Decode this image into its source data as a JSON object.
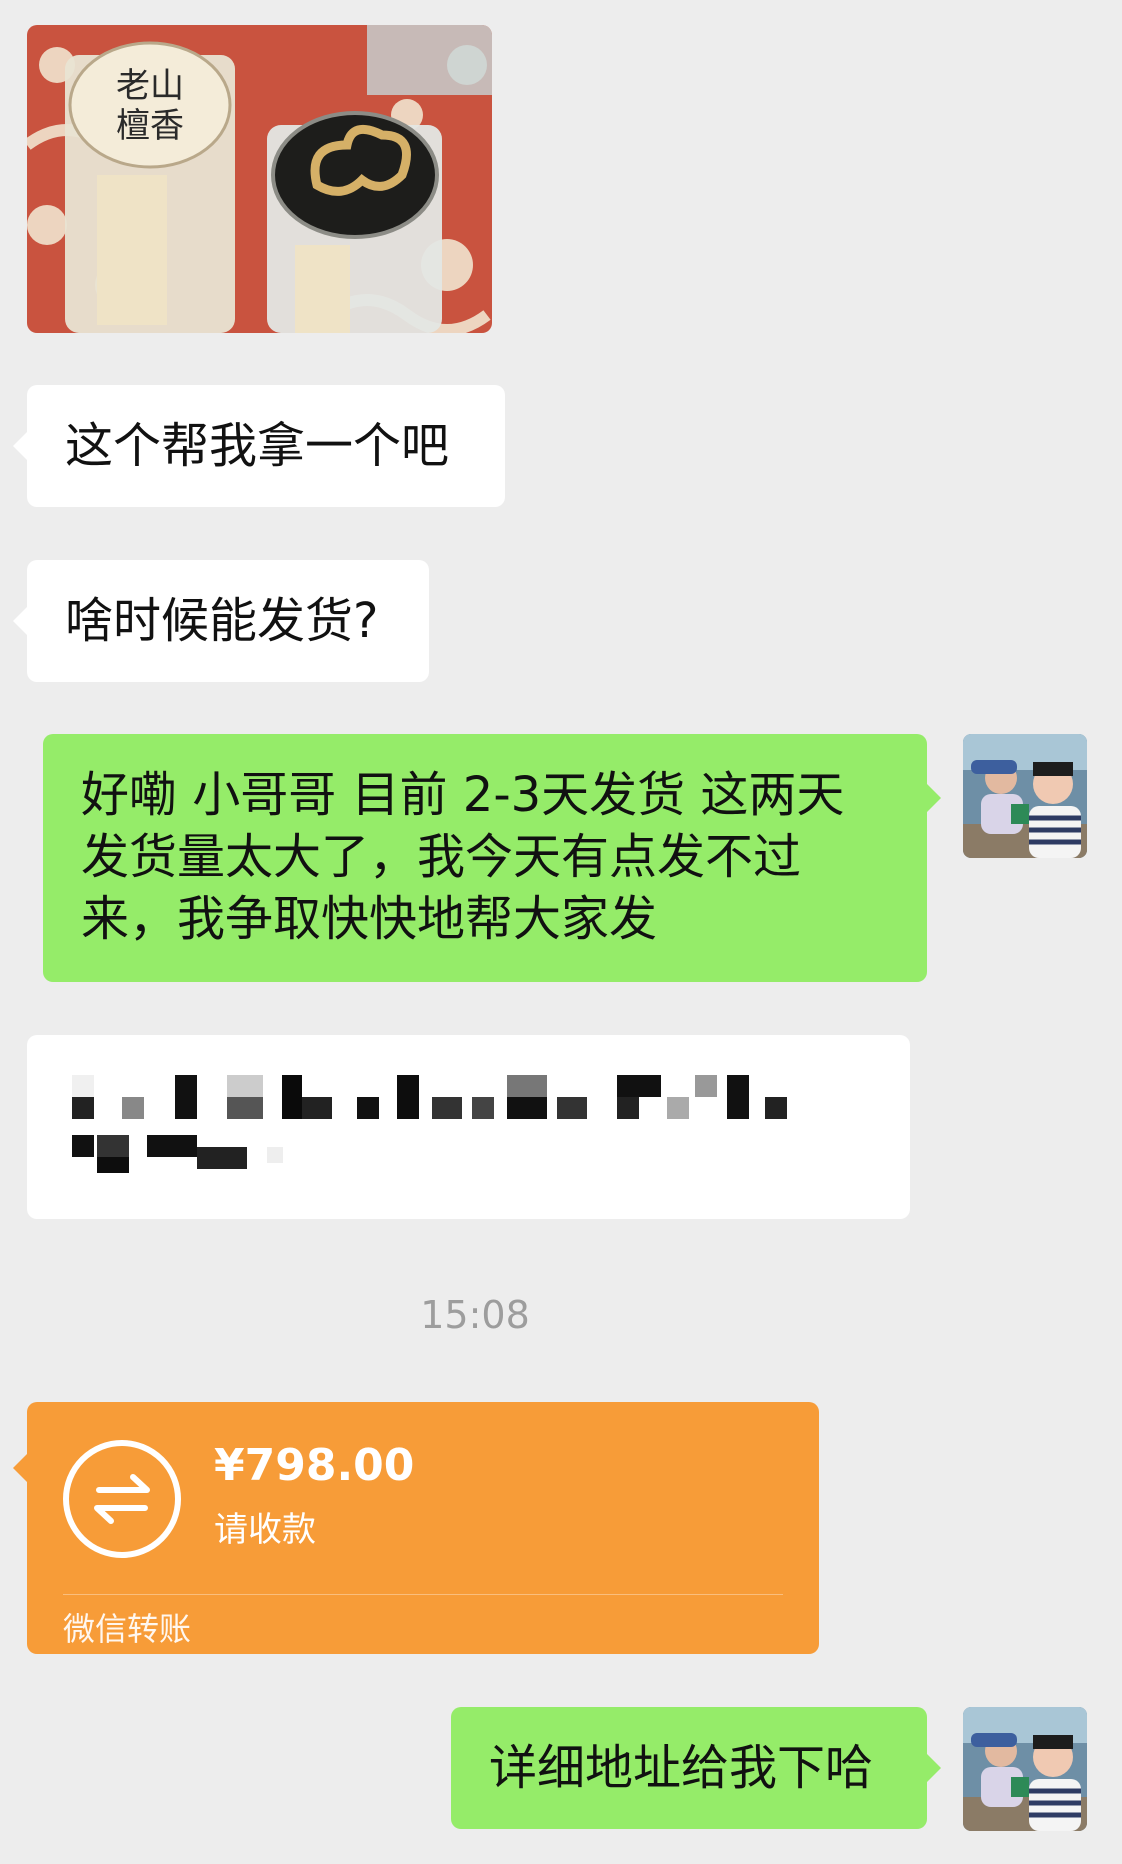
{
  "messages": {
    "image_message": {
      "label_lines": [
        "老山",
        "檀香"
      ]
    },
    "msg1": "这个帮我拿一个吧",
    "msg2": "啥时候能发货?",
    "msg3_lines": [
      "好嘞 小哥哥 目前 2-3天发货  这两天",
      "发货量太大了，我今天有点发不过",
      "来，我争取快快地帮大家发"
    ],
    "timestamp": "15:08",
    "transfer": {
      "amount": "¥798.00",
      "status": "请收款",
      "footer": "微信转账"
    },
    "msg5": "详细地址给我下哈"
  },
  "colors": {
    "background": "#ededed",
    "incoming_bubble": "#ffffff",
    "outgoing_bubble": "#95ec69",
    "transfer_card": "#f79c38"
  }
}
